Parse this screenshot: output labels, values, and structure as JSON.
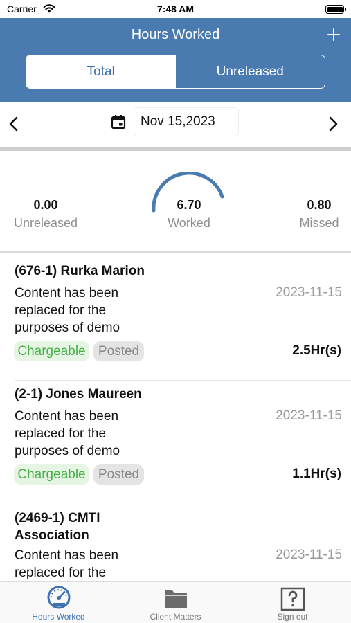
{
  "status_bar": {
    "carrier": "Carrier",
    "time": "7:48 AM"
  },
  "header": {
    "title": "Hours Worked",
    "segments": [
      "Total",
      "Unreleased"
    ],
    "active_segment": "Total"
  },
  "date_bar": {
    "date": "Nov 15,2023"
  },
  "stats": {
    "unreleased": {
      "value": "0.00",
      "label": "Unreleased"
    },
    "worked": {
      "value": "6.70",
      "label": "Worked"
    },
    "missed": {
      "value": "0.80",
      "label": "Missed"
    },
    "gauge_color": "#4a7bb0"
  },
  "entries": [
    {
      "title": "(676-1) Rurka Marion",
      "description": "Content has been replaced for the purposes of demo",
      "date": "2023-11-15",
      "tags": [
        "Chargeable",
        "Posted"
      ],
      "hours": "2.5Hr(s)"
    },
    {
      "title": "(2-1) Jones Maureen",
      "description": "Content has been replaced for the purposes of demo",
      "date": "2023-11-15",
      "tags": [
        "Chargeable",
        "Posted"
      ],
      "hours": "1.1Hr(s)"
    },
    {
      "title": "(2469-1)  CMTI Association",
      "description": "Content has been replaced for the",
      "date": "2023-11-15"
    }
  ],
  "tabbar": {
    "tabs": [
      {
        "label": "Hours Worked",
        "icon": "speedometer-icon",
        "active": true
      },
      {
        "label": "Client Matters",
        "icon": "folder-icon",
        "active": false
      },
      {
        "label": "Sign out",
        "icon": "question-icon",
        "active": false
      }
    ]
  },
  "colors": {
    "header": "#4a7bb0",
    "accent": "#3e72b2",
    "chargeable_text": "#49b04b",
    "chargeable_bg": "#e6f5e3",
    "posted_bg": "#e4e4e4"
  }
}
